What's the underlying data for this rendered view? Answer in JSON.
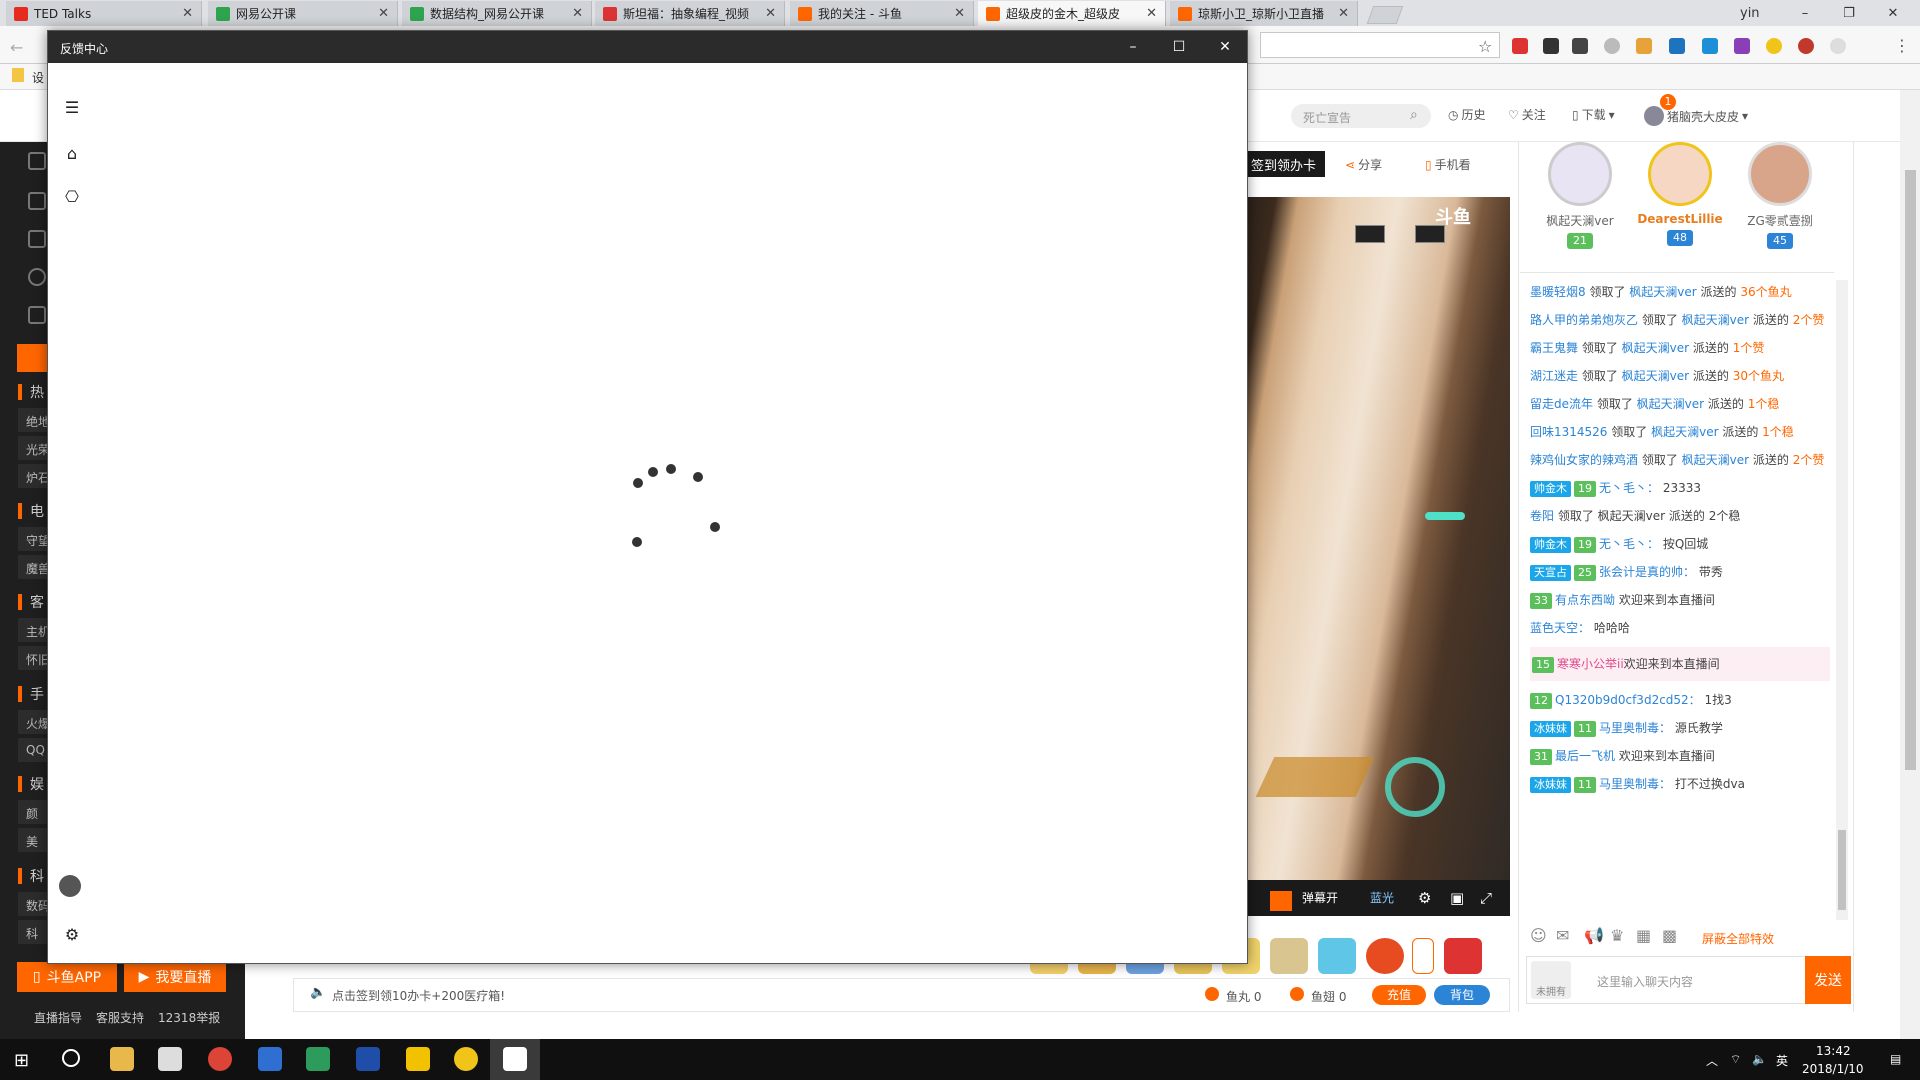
{
  "browser": {
    "tabs": [
      {
        "label": "TED Talks",
        "color": "#e62b1e"
      },
      {
        "label": "网易公开课",
        "color": "#2ea44f"
      },
      {
        "label": "数据结构_网易公开课",
        "color": "#2ea44f"
      },
      {
        "label": "斯坦福：抽象编程_视频",
        "color": "#d33"
      },
      {
        "label": "我的关注 - 斗鱼",
        "color": "#f60"
      },
      {
        "label": "超级皮的金木_超级皮",
        "color": "#f60"
      },
      {
        "label": "琼斯小卫_琼斯小卫直播",
        "color": "#f60"
      }
    ],
    "user_label": "yin",
    "bookmark_label": "设"
  },
  "site_header": {
    "search_placeholder": "死亡宣告",
    "history": "历史",
    "follow": "关注",
    "download": "下载",
    "username": "猪脑壳大皮皮",
    "notif_count": "1"
  },
  "leftnav": {
    "sections": [
      {
        "title": "热",
        "items": [
          "绝地",
          "光荣",
          "炉石"
        ]
      },
      {
        "title": "电",
        "items": [
          "守望",
          "魔兽"
        ]
      },
      {
        "title": "客",
        "items": [
          "主机",
          "怀旧"
        ]
      },
      {
        "title": "手",
        "items": [
          "火爆",
          "QQ"
        ]
      },
      {
        "title": "娱",
        "items": [
          "颜",
          "美"
        ]
      },
      {
        "title": "科",
        "items": [
          "数码",
          "科"
        ]
      }
    ],
    "app_button": "斗鱼APP",
    "live_button": "我要直播",
    "footer": [
      "直播指导",
      "客服支持",
      "12318举报"
    ]
  },
  "stream": {
    "checkin_label": "签到领办卡",
    "share": "分享",
    "mobile": "手机看",
    "danmaku_toggle": "弹幕开",
    "quality": "蓝光",
    "notice": "点击签到领10办卡+200医疗箱!",
    "fishball": "鱼丸 0",
    "fishfin": "鱼翅 0",
    "recharge": "充值",
    "backpack": "背包",
    "watermark": "斗鱼"
  },
  "ranking": [
    {
      "name": "枫起天澜ver",
      "level": "21",
      "color": "#5bc05b"
    },
    {
      "name": "DearestLillie",
      "level": "48",
      "color": "#2b84d6"
    },
    {
      "name": "ZG零贰壹捌",
      "level": "45",
      "color": "#2b84d6"
    }
  ],
  "chat": {
    "messages": [
      {
        "user": "墨暖轻烟8",
        "text": " 领取了 ",
        "from": "枫起天澜ver",
        "tail": " 派送的 ",
        "amount": "36个鱼丸"
      },
      {
        "user": "路人甲的弟弟炮灰乙",
        "text": " 领取了 ",
        "from": "枫起天澜ver",
        "tail": " 派送的 ",
        "amount": "2个赞"
      },
      {
        "user": "霸王鬼舞",
        "text": " 领取了 ",
        "from": "枫起天澜ver",
        "tail": " 派送的 ",
        "amount": "1个赞"
      },
      {
        "user": "湖江迷走",
        "text": " 领取了 ",
        "from": "枫起天澜ver",
        "tail": " 派送的 ",
        "amount": "30个鱼丸"
      },
      {
        "user": "留走de流年",
        "text": " 领取了 ",
        "from": "枫起天澜ver",
        "tail": " 派送的 ",
        "amount": "1个稳"
      },
      {
        "user": "回味1314526",
        "text": " 领取了 ",
        "from": "枫起天澜ver",
        "tail": " 派送的 ",
        "amount": "1个稳"
      },
      {
        "user": "辣鸡仙女家的辣鸡酒",
        "text": " 领取了 ",
        "from": "枫起天澜ver",
        "tail": " 派送的 ",
        "amount": "2个赞"
      }
    ],
    "talk": [
      {
        "badge": "帅金木",
        "lv": "19",
        "user": "无丶毛丶：",
        "text": "23333"
      },
      {
        "badge": "",
        "lv": "",
        "user": "卷阳",
        "text": "领取了 枫起天澜ver 派送的 2个稳"
      },
      {
        "badge": "帅金木",
        "lv": "19",
        "user": "无丶毛丶：",
        "text": "按Q回城"
      },
      {
        "badge": "天宣占",
        "lv": "25",
        "user": "张会计是真的帅：",
        "text": "带秀"
      },
      {
        "badge": "",
        "lv": "33",
        "user": "有点东西呦",
        "text": "欢迎来到本直播间"
      },
      {
        "badge": "",
        "lv": "",
        "user": "蓝色天空：",
        "text": "哈哈哈"
      }
    ],
    "welcome": {
      "lv": "15",
      "user": "寒寒小公举ii",
      "text": "欢迎来到本直播间"
    },
    "talk2": [
      {
        "badge": "",
        "lv": "12",
        "user": "Q1320b9d0cf3d2cd52：",
        "text": "1找3"
      },
      {
        "badge": "冰妹妹",
        "lv": "11",
        "user": "马里奥制毒：",
        "text": "源氏教学"
      },
      {
        "badge": "",
        "lv": "31",
        "user": "最后一飞机",
        "text": "欢迎来到本直播间"
      },
      {
        "badge": "冰妹妹",
        "lv": "11",
        "user": "马里奥制毒：",
        "text": "打不过换dva"
      }
    ],
    "block_effects": "屏蔽全部特效",
    "input_placeholder": "这里输入聊天内容",
    "send": "发送",
    "not_owned": "未拥有"
  },
  "feedback_window": {
    "title": "反馈中心"
  },
  "taskbar": {
    "time": "13:42",
    "date": "2018/1/10",
    "ime": "英"
  }
}
